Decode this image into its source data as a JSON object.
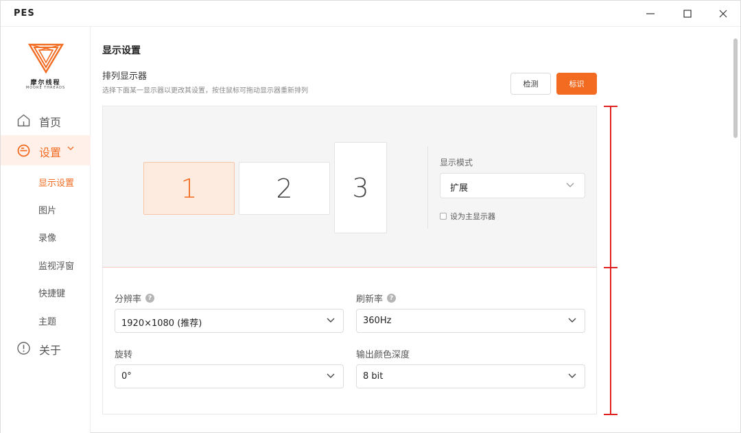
{
  "app": {
    "title": "PES"
  },
  "window_controls": {
    "minimize": "minimize",
    "maximize": "maximize",
    "close": "close"
  },
  "logo": {
    "cn": "摩尔线程",
    "en": "MOORE THREADS"
  },
  "nav": {
    "home": "首页",
    "settings": "设置",
    "about": "关于",
    "sub": {
      "display": "显示设置",
      "picture": "图片",
      "recording": "录像",
      "monitor_float": "监视浮窗",
      "shortcut": "快捷键",
      "theme": "主题"
    }
  },
  "page": {
    "title": "显示设置",
    "section_title": "排列显示器",
    "section_desc": "选择下面某一显示器以更改其设置，按住鼠标可拖动显示器重新排列",
    "detect_button": "检测",
    "identify_button": "标识"
  },
  "arrangement": {
    "monitors": [
      "1",
      "2",
      "3"
    ],
    "selected_monitor": "1",
    "mode_label": "显示模式",
    "mode_value": "扩展",
    "primary_label": "设为主显示器",
    "primary_checked": false
  },
  "settings": {
    "resolution_label": "分辨率",
    "resolution_value": "1920×1080 (推荐)",
    "refresh_label": "刷新率",
    "refresh_value": "360Hz",
    "rotation_label": "旋转",
    "rotation_value": "0°",
    "color_depth_label": "输出颜色深度",
    "color_depth_value": "8 bit"
  },
  "colors": {
    "accent": "#f26b21",
    "measure": "#e02020"
  }
}
